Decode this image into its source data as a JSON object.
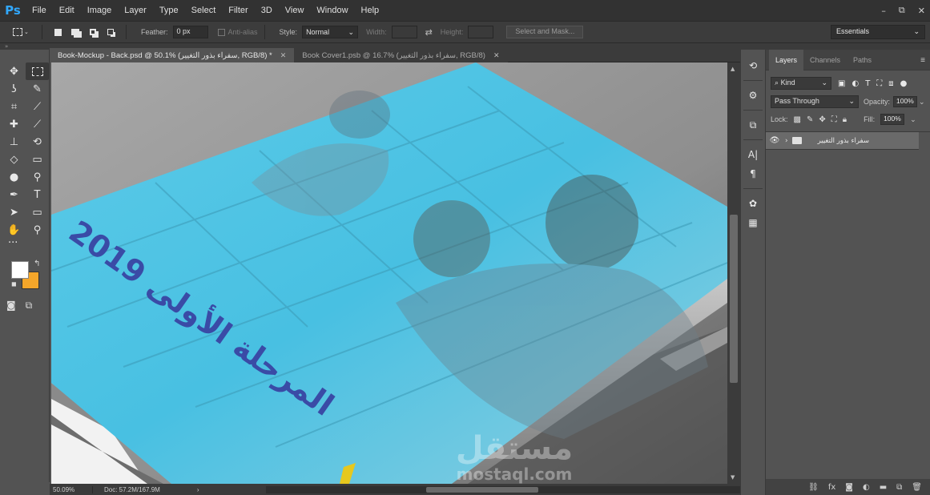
{
  "app": {
    "logo": "Ps"
  },
  "menu": [
    "File",
    "Edit",
    "Image",
    "Layer",
    "Type",
    "Select",
    "Filter",
    "3D",
    "View",
    "Window",
    "Help"
  ],
  "window_controls": {
    "minimize": "–",
    "restore": "⧉",
    "close": "✕"
  },
  "options": {
    "feather_label": "Feather:",
    "feather_value": "0 px",
    "antialias_label": "Anti-alias",
    "style_label": "Style:",
    "style_value": "Normal",
    "width_label": "Width:",
    "height_label": "Height:",
    "select_mask_label": "Select and Mask...",
    "workspace": "Essentials"
  },
  "tabs": [
    {
      "label": "Book-Mockup - Back.psd @ 50.1% (سفراء بذور التغيير, RGB/8) *",
      "active": true
    },
    {
      "label": "Book Cover1.psb @ 16.7% (سفراء بذور التغيير, RGB/8)",
      "active": false
    }
  ],
  "canvas": {
    "cover_text": "المرحلة الأولى 2019",
    "watermark_arabic": "مستقل",
    "watermark_latin": "mostaql.com",
    "colors": {
      "cover": "#48c0e2",
      "title": "#3a4ba6",
      "background": "#9c9c9c",
      "spine": "#e6c81e"
    }
  },
  "status": {
    "zoom": "50.09%",
    "doc": "Doc: 57.2M/167.9M"
  },
  "colors": {
    "foreground": "#ffffff",
    "background": "#f4a62a"
  },
  "layers_panel": {
    "tabs": [
      "Layers",
      "Channels",
      "Paths"
    ],
    "filter_kind": "Kind",
    "blend_mode": "Pass Through",
    "opacity_label": "Opacity:",
    "opacity_value": "100%",
    "lock_label": "Lock:",
    "fill_label": "Fill:",
    "fill_value": "100%",
    "layers": [
      {
        "name": "سفراء بذور التغيير",
        "type": "group",
        "visible": true
      }
    ]
  }
}
